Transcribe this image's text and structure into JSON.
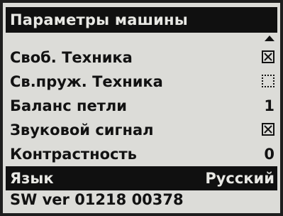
{
  "title": "Параметры машины",
  "menu": [
    {
      "label": "Своб. Техника",
      "control": "checkbox",
      "checked": true
    },
    {
      "label": "Св.пруж. Техника",
      "control": "checkbox",
      "checked": false
    },
    {
      "label": "Баланс петли",
      "control": "value",
      "value": "1"
    },
    {
      "label": "Звуковой сигнал",
      "control": "checkbox",
      "checked": true
    },
    {
      "label": "Контрастность",
      "control": "value",
      "value": "0"
    },
    {
      "label": "Язык",
      "control": "value",
      "value": "Русский",
      "selected": true
    }
  ],
  "version": "SW ver 01218 00378",
  "icons": {
    "scroll": "scroll-up-icon"
  }
}
